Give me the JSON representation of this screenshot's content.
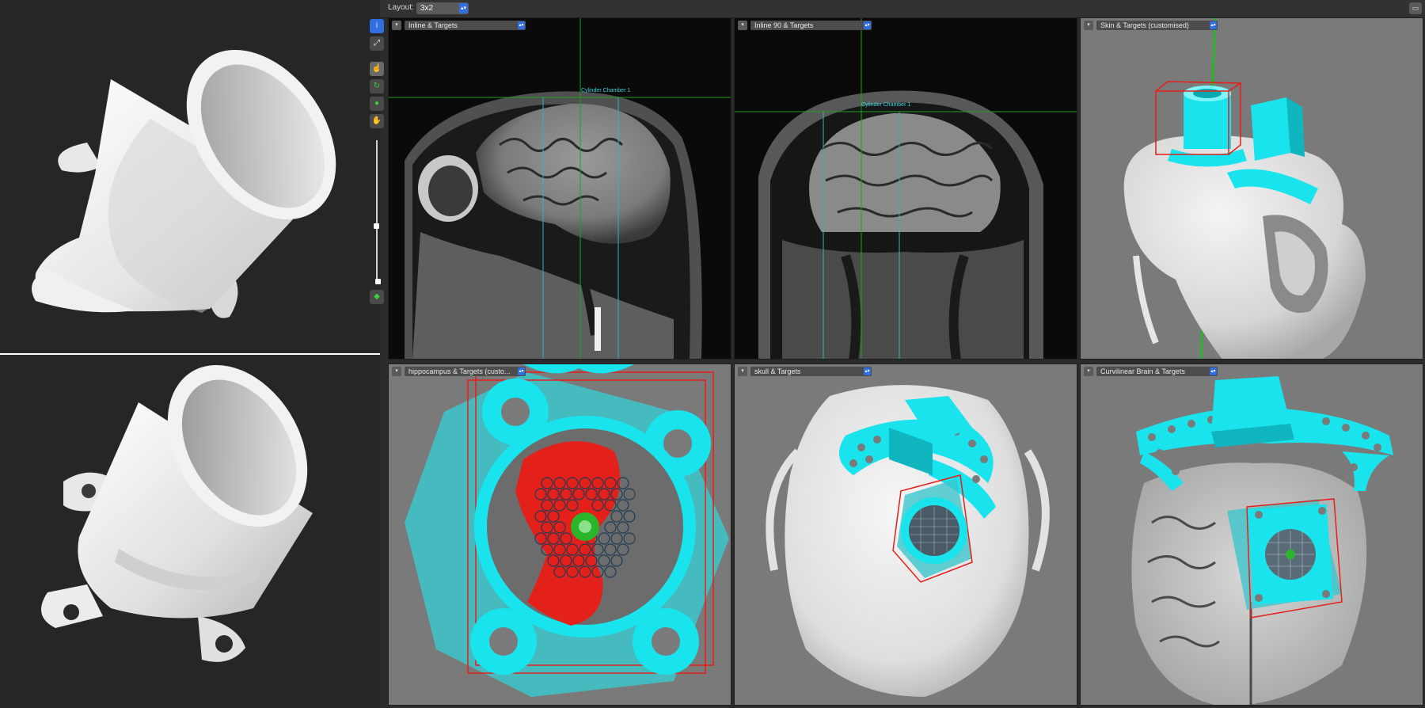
{
  "topbar": {
    "layout_label": "Layout:",
    "layout_value": "3x2",
    "corner_icon": "panel-toggle-icon"
  },
  "toolbar": {
    "icons": [
      "info-icon",
      "fullscreen-icon",
      "pointer-icon",
      "rotate-icon",
      "globe-icon",
      "hand-icon",
      "green-tool-icon"
    ]
  },
  "views": [
    {
      "title": "Inline & Targets",
      "annotation": "Cylinder Chamber 1"
    },
    {
      "title": "Inline 90 & Targets",
      "annotation": "Cylinder Chamber 1"
    },
    {
      "title": "Skin & Targets (customised)"
    },
    {
      "title": "hippocampus & Targets (custo..."
    },
    {
      "title": "skull & Targets"
    },
    {
      "title": "Curvilinear Brain & Targets"
    }
  ],
  "colors": {
    "cyan": "#19e3ec",
    "red": "#e3201a",
    "green": "#2bb52b",
    "view_bg": "#7a7a7a",
    "toolbar_bg": "#323232",
    "select_arrow": "#2f6fe0"
  }
}
